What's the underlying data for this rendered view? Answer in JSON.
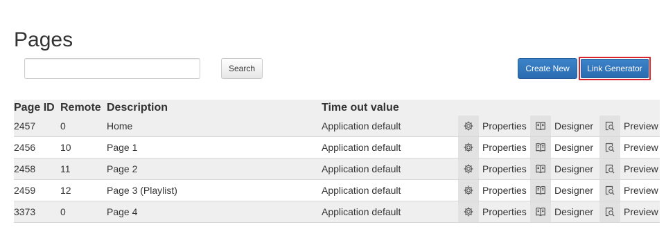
{
  "page": {
    "title": "Pages"
  },
  "search": {
    "value": "",
    "placeholder": "",
    "button_label": "Search"
  },
  "toolbar": {
    "create_label": "Create New",
    "link_generator_label": "Link Generator"
  },
  "table": {
    "columns": {
      "id": "Page ID",
      "remote": "Remote",
      "description": "Description",
      "timeout": "Time out value"
    },
    "actions": {
      "properties": "Properties",
      "designer": "Designer",
      "preview": "Preview"
    },
    "action_icons": {
      "properties": "gear-icon",
      "designer": "book-icon",
      "preview": "preview-magnifier-icon"
    },
    "rows": [
      {
        "id": "2457",
        "remote": "0",
        "description": "Home",
        "timeout": "Application default"
      },
      {
        "id": "2456",
        "remote": "10",
        "description": "Page 1",
        "timeout": "Application default"
      },
      {
        "id": "2458",
        "remote": "11",
        "description": "Page 2",
        "timeout": "Application default"
      },
      {
        "id": "2459",
        "remote": "12",
        "description": "Page 3 (Playlist)",
        "timeout": "Application default"
      },
      {
        "id": "3373",
        "remote": "0",
        "description": "Page 4",
        "timeout": "Application default"
      }
    ]
  },
  "colors": {
    "primary_button": "#337ab7",
    "highlight_border": "#d9232d",
    "row_stripe": "#efefef"
  }
}
